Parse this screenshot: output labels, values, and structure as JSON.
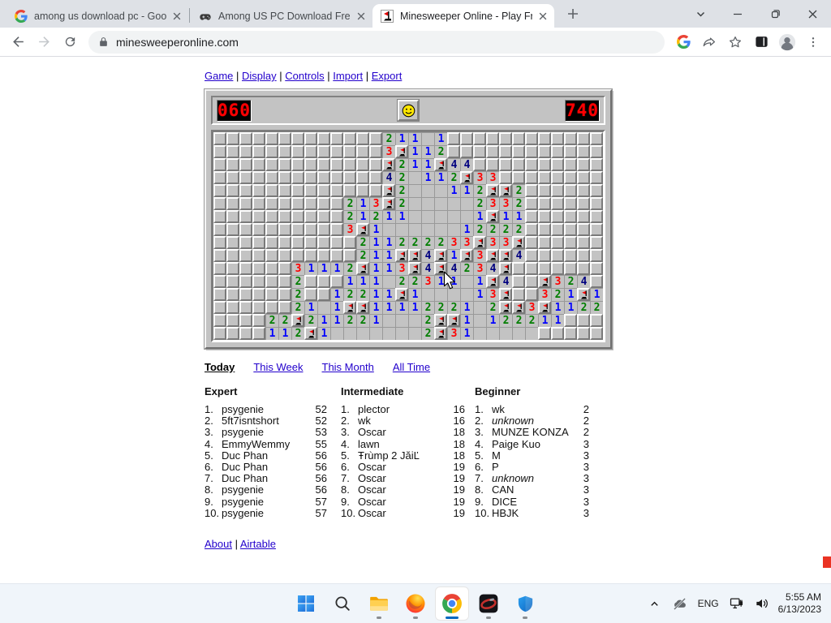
{
  "browser": {
    "tab_bar": {
      "tabs": [
        {
          "title": "among us download pc - Google",
          "favicon": "google",
          "active": false
        },
        {
          "title": "Among US PC Download Free Ga",
          "favicon": "gamepad",
          "active": false
        },
        {
          "title": "Minesweeper Online - Play Free",
          "favicon": "minesweeper",
          "active": true
        }
      ]
    },
    "toolbar": {
      "url": "minesweeperonline.com"
    }
  },
  "page": {
    "menu": {
      "separator": "|",
      "items": [
        "Game",
        "Display",
        "Controls",
        "Import",
        "Export"
      ]
    },
    "game": {
      "mines_counter": "060",
      "timer": "740",
      "board_rows": [
        ".............21101............",
        ".............3F112............",
        ".............F211F44..........",
        ".............420112F33........",
        ".............F2000112FF2......",
        "..........213F2000002332......",
        "..........21211000001F11......",
        "..........3F100000012222......",
        "...........211222233F33F......",
        "...........211FF4F1F3FF4......",
        "......31112F113F4F4234F.......",
        "......2...11102231101F4..F324.",
        "......2..12211F1000013F..321F1",
        "......2101FF1111222102FF3F1122",
        "....22F2112210002FF10122211...",
        "....112F100000002F3100000....."
      ]
    },
    "leaderboard": {
      "tabs": [
        {
          "label": "Today",
          "active": true
        },
        {
          "label": "This Week",
          "active": false
        },
        {
          "label": "This Month",
          "active": false
        },
        {
          "label": "All Time",
          "active": false
        }
      ],
      "columns": [
        {
          "title": "Expert",
          "entries": [
            {
              "rank": "1.",
              "name": "psygenie",
              "score": "52"
            },
            {
              "rank": "2.",
              "name": "5ft7isntshort",
              "score": "52"
            },
            {
              "rank": "3.",
              "name": "psygenie",
              "score": "53"
            },
            {
              "rank": "4.",
              "name": "EmmyWemmy",
              "score": "55"
            },
            {
              "rank": "5.",
              "name": "Duc Phan",
              "score": "56"
            },
            {
              "rank": "6.",
              "name": "Duc Phan",
              "score": "56"
            },
            {
              "rank": "7.",
              "name": "Duc Phan",
              "score": "56"
            },
            {
              "rank": "8.",
              "name": "psygenie",
              "score": "56"
            },
            {
              "rank": "9.",
              "name": "psygenie",
              "score": "57"
            },
            {
              "rank": "10.",
              "name": "psygenie",
              "score": "57"
            }
          ]
        },
        {
          "title": "Intermediate",
          "entries": [
            {
              "rank": "1.",
              "name": "plector",
              "score": "16"
            },
            {
              "rank": "2.",
              "name": "wk",
              "score": "16"
            },
            {
              "rank": "3.",
              "name": "Oscar",
              "score": "18"
            },
            {
              "rank": "4.",
              "name": "lawn",
              "score": "18"
            },
            {
              "rank": "5.",
              "name": "Ŧrùmp 2 JăiĽ",
              "score": "18"
            },
            {
              "rank": "6.",
              "name": "Oscar",
              "score": "19"
            },
            {
              "rank": "7.",
              "name": "Oscar",
              "score": "19"
            },
            {
              "rank": "8.",
              "name": "Oscar",
              "score": "19"
            },
            {
              "rank": "9.",
              "name": "Oscar",
              "score": "19"
            },
            {
              "rank": "10.",
              "name": "Oscar",
              "score": "19"
            }
          ]
        },
        {
          "title": "Beginner",
          "entries": [
            {
              "rank": "1.",
              "name": "wk",
              "score": "2"
            },
            {
              "rank": "2.",
              "name": "unknown",
              "score": "2",
              "italic": true
            },
            {
              "rank": "3.",
              "name": "MUNZE KONZA",
              "score": "2"
            },
            {
              "rank": "4.",
              "name": "Paige Kuo",
              "score": "3"
            },
            {
              "rank": "5.",
              "name": "M",
              "score": "3"
            },
            {
              "rank": "6.",
              "name": "P",
              "score": "3"
            },
            {
              "rank": "7.",
              "name": "unknown",
              "score": "3",
              "italic": true
            },
            {
              "rank": "8.",
              "name": "CAN",
              "score": "3"
            },
            {
              "rank": "9.",
              "name": "DICE",
              "score": "3"
            },
            {
              "rank": "10.",
              "name": "HBJK",
              "score": "3"
            }
          ]
        }
      ]
    },
    "footer_links": [
      "About",
      "Airtable"
    ]
  },
  "taskbar": {
    "apps": [
      {
        "name": "start",
        "indicator": false,
        "active": false
      },
      {
        "name": "search",
        "indicator": false,
        "active": false
      },
      {
        "name": "file-explorer",
        "indicator": true,
        "active": false
      },
      {
        "name": "firefox",
        "indicator": true,
        "active": false
      },
      {
        "name": "chrome",
        "indicator": true,
        "active": true
      },
      {
        "name": "media-app",
        "indicator": true,
        "active": false
      },
      {
        "name": "defender",
        "indicator": true,
        "active": false
      }
    ],
    "tray": {
      "language": "ENG",
      "time": "5:55 AM",
      "date": "6/13/2023"
    }
  }
}
